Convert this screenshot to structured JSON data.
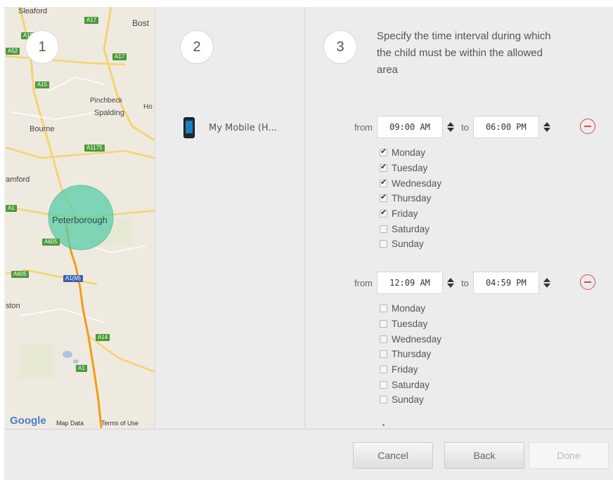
{
  "steps": {
    "one": "1",
    "two": "2",
    "three": "3"
  },
  "map": {
    "places": [
      "Sleaford",
      "Bost",
      "Pinchbeck",
      "Spalding",
      "Ho",
      "Bourne",
      "amford",
      "Peterborough",
      "ston"
    ],
    "roads": [
      "A17",
      "A17",
      "A52",
      "A15",
      "A15",
      "A1175",
      "A1",
      "A605",
      "A605",
      "A1(M)",
      "A14",
      "A1"
    ],
    "attribution": {
      "logo": "Google",
      "map_data": "Map Data",
      "terms": "Terms of Use"
    },
    "colors": {
      "zone": "#59cfa8",
      "route": "#f39a1a",
      "land": "#efeadf"
    }
  },
  "device": {
    "name": "My Mobile (H...",
    "icon": "mobile-phone-icon"
  },
  "schedule": {
    "title": "Specify the time interval during which the child must be within the allowed area",
    "intervals": [
      {
        "from_label": "from",
        "from": "09:00 AM",
        "to_label": "to",
        "to": "06:00 PM",
        "days": [
          {
            "label": "Monday",
            "checked": true
          },
          {
            "label": "Tuesday",
            "checked": true
          },
          {
            "label": "Wednesday",
            "checked": true
          },
          {
            "label": "Thursday",
            "checked": true
          },
          {
            "label": "Friday",
            "checked": true
          },
          {
            "label": "Saturday",
            "checked": false
          },
          {
            "label": "Sunday",
            "checked": false
          }
        ]
      },
      {
        "from_label": "from",
        "from": "12:09 AM",
        "to_label": "to",
        "to": "04:59 PM",
        "days": [
          {
            "label": "Monday",
            "checked": false
          },
          {
            "label": "Tuesday",
            "checked": false
          },
          {
            "label": "Wednesday",
            "checked": false
          },
          {
            "label": "Thursday",
            "checked": false
          },
          {
            "label": "Friday",
            "checked": false
          },
          {
            "label": "Saturday",
            "checked": false
          },
          {
            "label": "Sunday",
            "checked": false
          }
        ]
      }
    ]
  },
  "footer": {
    "cancel": "Cancel",
    "back": "Back",
    "done": "Done"
  }
}
